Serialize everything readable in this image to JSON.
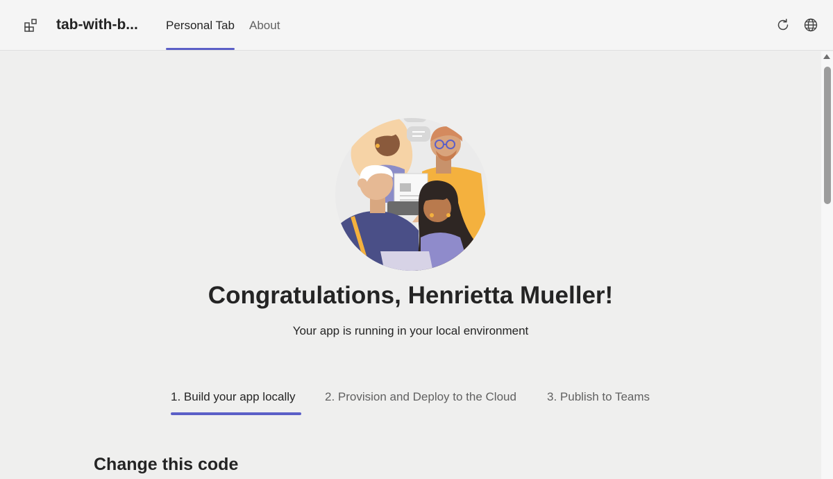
{
  "header": {
    "app_title": "tab-with-b...",
    "tabs": [
      {
        "label": "Personal Tab",
        "active": true
      },
      {
        "label": "About",
        "active": false
      }
    ],
    "icons": [
      "apps-icon",
      "refresh-icon",
      "globe-icon"
    ]
  },
  "main": {
    "headline": "Congratulations, Henrietta Mueller!",
    "subline": "Your app is running in your local environment",
    "steps": [
      {
        "label": "1. Build your app locally",
        "active": true
      },
      {
        "label": "2. Provision and Deploy to the Cloud",
        "active": false
      },
      {
        "label": "3. Publish to Teams",
        "active": false
      }
    ],
    "section_title": "Change this code"
  },
  "colors": {
    "accent": "#5b5fc7",
    "background": "#efefee",
    "header_background": "#f5f5f5",
    "text": "#242424",
    "muted_text": "#616161"
  }
}
